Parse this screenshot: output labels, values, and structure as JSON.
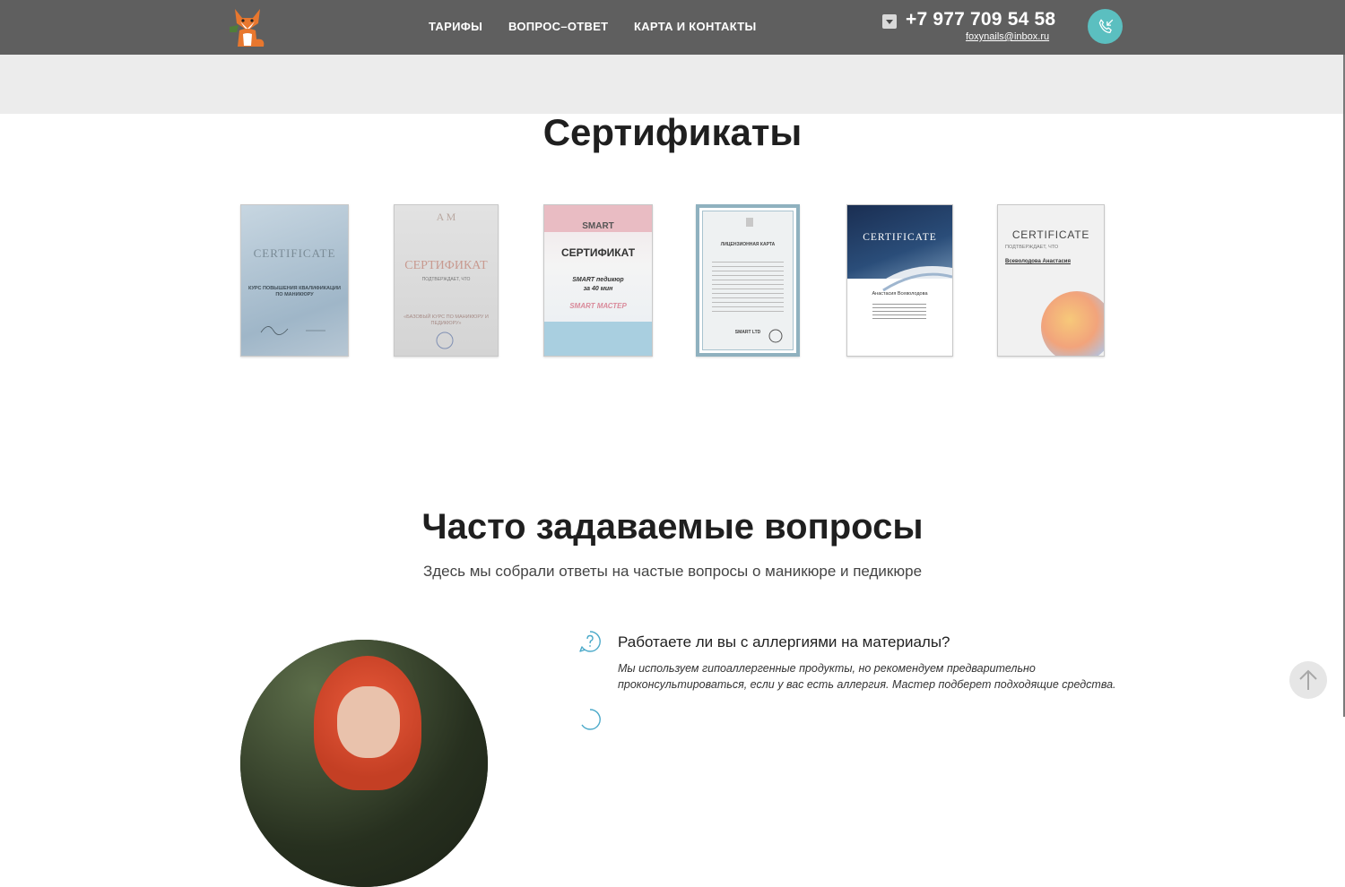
{
  "header": {
    "nav": [
      {
        "label": "ТАРИФЫ"
      },
      {
        "label": "ВОПРОС–ОТВЕТ"
      },
      {
        "label": "КАРТА И КОНТАКТЫ"
      }
    ],
    "phone": "+7 977 709 54 58",
    "email": "foxynails@inbox.ru",
    "logo_icon": "fox-logo-icon",
    "call_icon": "phone-callback-icon"
  },
  "certificates": {
    "title": "Сертификаты",
    "items": [
      {
        "heading": "CERTIFICATE",
        "line1": "КУРС ПОВЫШЕНИЯ КВАЛИФИКАЦИИ",
        "line2": "ПО МАНИКЮРУ",
        "tone": "#b9cad6"
      },
      {
        "heading": "СЕРТИФИКАТ",
        "line1": "ПОДТВЕРЖДАЕТ, ЧТО",
        "line2": "«БАЗОВЫЙ КУРС ПО МАНИКЮРУ И ПЕДИКЮРУ»",
        "tone": "#dcdcdc"
      },
      {
        "brand": "SMART",
        "heading": "СЕРТИФИКАТ",
        "line1": "SMART педикюр",
        "line2": "за 40 мин",
        "line3": "SMART МАСТЕР",
        "tone": "#e8dfe2"
      },
      {
        "heading": "ЛИЦЕНЗИОННАЯ КАРТА",
        "line1": "SMART LTD",
        "tone": "#d7dde0"
      },
      {
        "heading": "CERTIFICATE",
        "line1": "Анастасия Всеволодова",
        "tone": "#1f3556"
      },
      {
        "heading": "CERTIFICATE",
        "line1": "ПОДТВЕРЖДАЕТ, ЧТО",
        "line2": "Всеволодова Анастасия",
        "tone": "#eeeeee"
      }
    ]
  },
  "faq": {
    "title": "Часто задаваемые вопросы",
    "subtitle": "Здесь мы собрали ответы на частые вопросы о маникюре и педикюре",
    "items": [
      {
        "question": "Работаете ли вы с аллергиями на материалы?",
        "answer": "Мы используем гипоаллергенные продукты, но рекомендуем предварительно проконсультироваться, если у вас есть аллергия. Мастер подберет подходящие средства."
      }
    ]
  },
  "colors": {
    "header_bg": "#5f5f5f",
    "accent": "#5bbfc0",
    "faq_icon": "#4aa9c9"
  }
}
